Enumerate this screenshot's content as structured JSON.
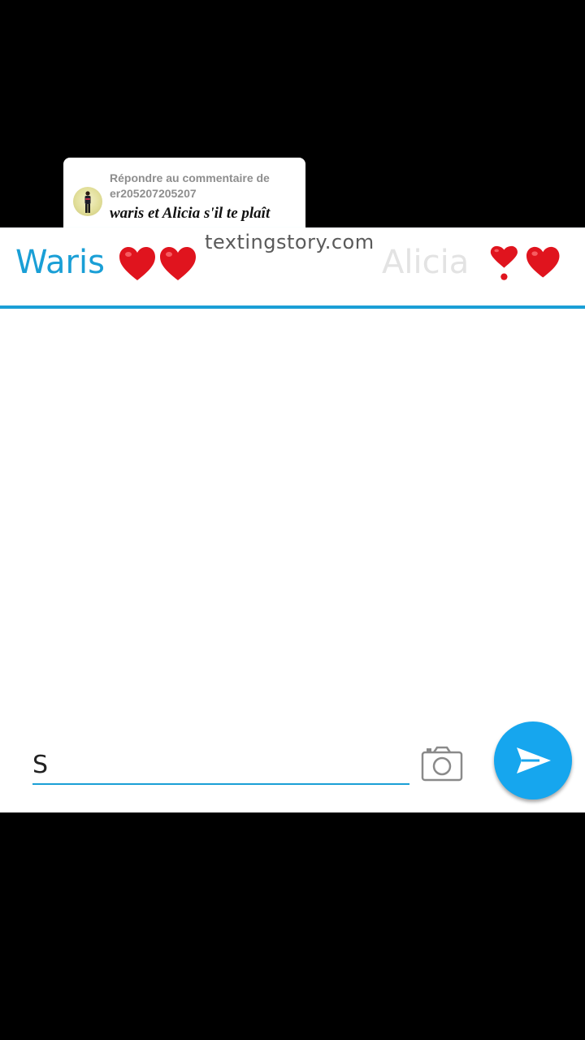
{
  "reply_card": {
    "heading": "Répondre au commentaire de er205207205207",
    "comment": "waris et Alicia s'il te plaît"
  },
  "chat": {
    "watermark": "textingstory.com",
    "left_contact": "Waris",
    "right_contact": "Alicia",
    "left_icons": [
      "red-heart-icon",
      "red-heart-icon"
    ],
    "right_icons": [
      "heart-exclamation-icon",
      "red-heart-icon"
    ]
  },
  "composer": {
    "input_value": "S",
    "camera_icon": "camera-icon",
    "send_icon": "send-icon"
  },
  "colors": {
    "accent": "#1a9fd6",
    "send_button": "#16a6ee",
    "heart": "#e0141e",
    "inactive_contact": "#e3e3e3"
  }
}
